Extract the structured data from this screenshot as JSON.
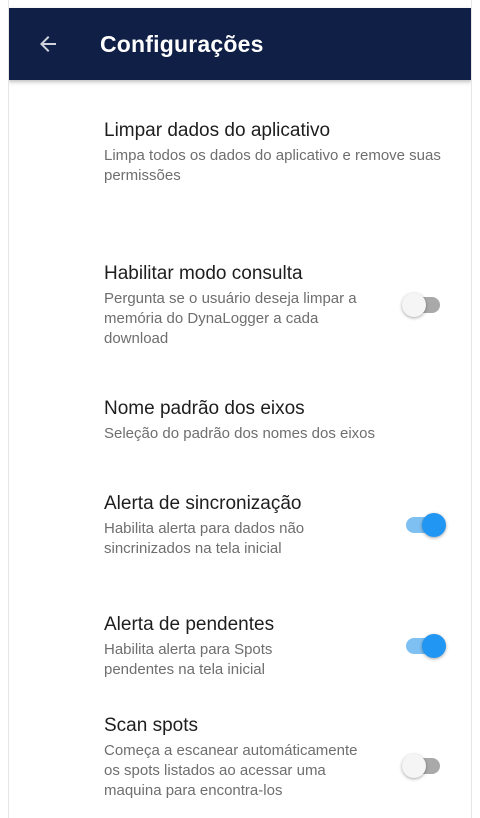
{
  "app_bar": {
    "title": "Configurações",
    "back_icon": "arrow-left-icon",
    "background": "#0f1f45"
  },
  "accent_color": "#2196f3",
  "settings": [
    {
      "title": "Limpar dados do aplicativo",
      "subtitle": "Limpa todos os dados do aplicativo e remove suas permissões"
    },
    {
      "title": "Habilitar modo consulta",
      "subtitle": "Pergunta se o usuário deseja limpar a memória do DynaLogger a cada download",
      "toggle": false
    },
    {
      "title": "Nome padrão dos eixos",
      "subtitle": "Seleção do padrão dos nomes dos eixos"
    },
    {
      "title": "Alerta de sincronização",
      "subtitle": "Habilita alerta para dados não sincrinizados na tela inicial",
      "toggle": true
    },
    {
      "title": "Alerta de pendentes",
      "subtitle": "Habilita alerta para Spots pendentes na tela inicial",
      "toggle": true
    },
    {
      "title": "Scan spots",
      "subtitle": "Começa a escanear automáticamente os spots listados ao acessar uma maquina para encontra-los",
      "toggle": false
    }
  ]
}
